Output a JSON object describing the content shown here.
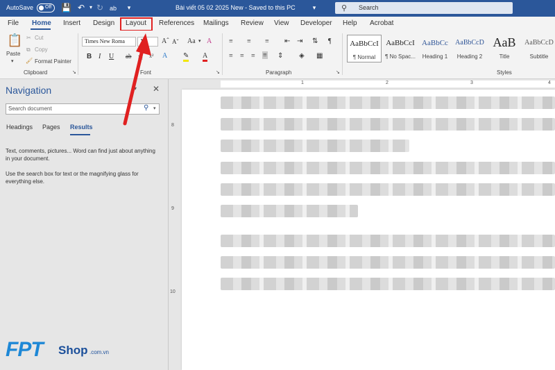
{
  "titlebar": {
    "autosave_label": "AutoSave",
    "autosave_state": "Off",
    "doc_title": "Bài viết 05 02 2025 New  -  Saved to this PC",
    "search_placeholder": "Search"
  },
  "tabs": [
    "File",
    "Home",
    "Insert",
    "Design",
    "Layout",
    "References",
    "Mailings",
    "Review",
    "View",
    "Developer",
    "Help",
    "Acrobat"
  ],
  "active_tab": "Home",
  "highlighted_tab": "Layout",
  "ribbon": {
    "clipboard": {
      "paste": "Paste",
      "cut": "Cut",
      "copy": "Copy",
      "format_painter": "Format Painter",
      "label": "Clipboard"
    },
    "font": {
      "font_name": "Times New Roma",
      "font_size": "14",
      "label": "Font"
    },
    "paragraph": {
      "label": "Paragraph"
    },
    "styles": {
      "label": "Styles",
      "items": [
        {
          "sample": "AaBbCcI",
          "name": "¶ Normal"
        },
        {
          "sample": "AaBbCcI",
          "name": "¶ No Spac..."
        },
        {
          "sample": "AaBbCc",
          "name": "Heading 1"
        },
        {
          "sample": "AaBbCcD",
          "name": "Heading 2"
        },
        {
          "sample": "AaB",
          "name": "Title"
        },
        {
          "sample": "AaBbCcD",
          "name": "Subtitle"
        }
      ]
    }
  },
  "navigation": {
    "title": "Navigation",
    "search_placeholder": "Search document",
    "tabs": [
      "Headings",
      "Pages",
      "Results"
    ],
    "active_tab": "Results",
    "message1": "Text, comments, pictures... Word can find just about anything in your document.",
    "message2": "Use the search box for text or the magnifying glass for everything else."
  },
  "ruler": {
    "h_numbers": [
      "1",
      "2",
      "3",
      "4"
    ],
    "v_numbers": [
      "8",
      "9",
      "10"
    ]
  },
  "logo": {
    "brand": "FPT",
    "shop": "Shop",
    "domain": ".com.vn"
  },
  "colors": {
    "accent": "#2b579a",
    "highlight": "#e02020"
  }
}
